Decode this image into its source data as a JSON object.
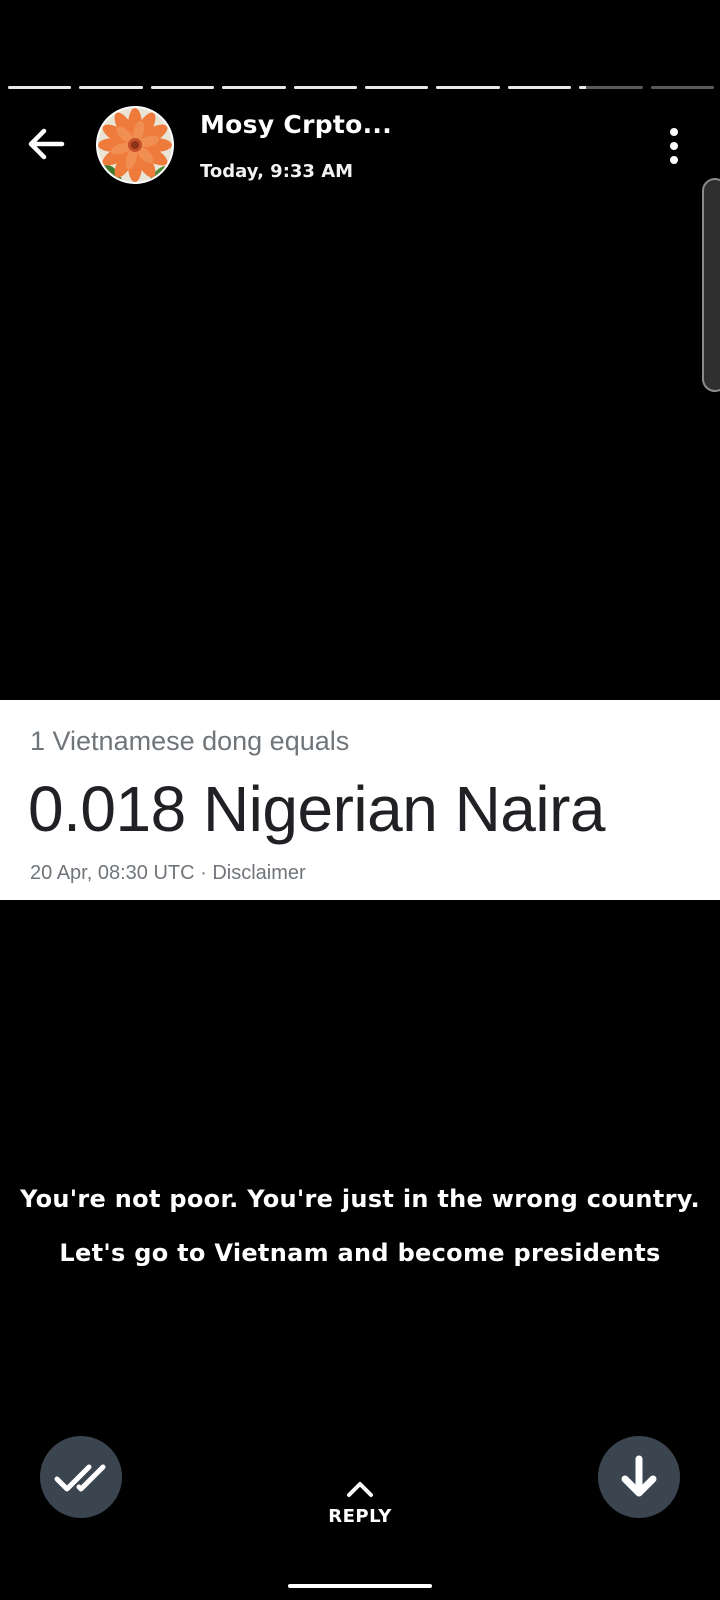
{
  "status_progress": {
    "segment_fill": [
      1,
      1,
      1,
      1,
      1,
      1,
      1,
      1,
      0.1,
      0
    ],
    "active_color": "#e8e8e8",
    "inactive_color": "#5a5a5a"
  },
  "header": {
    "contact_name": "Mosy Crpto...",
    "timestamp": "Today, 9:33 AM",
    "back_icon": "arrow-left-icon",
    "menu_icon": "more-vertical-icon",
    "avatar_icon": "orange-flower-avatar"
  },
  "card": {
    "subtitle": "1 Vietnamese dong equals",
    "result": "0.018 Nigerian Naira",
    "footer": "20 Apr, 08:30 UTC · Disclaimer"
  },
  "caption": {
    "line1": "You're not poor. You're just in the wrong country.",
    "line2": "Let's go to Vietnam and become presidents"
  },
  "controls": {
    "seen_icon": "double-check-icon",
    "reply_icon": "chevron-up-icon",
    "reply_label": "REPLY",
    "download_icon": "arrow-down-icon",
    "button_color": "#3b4550"
  }
}
